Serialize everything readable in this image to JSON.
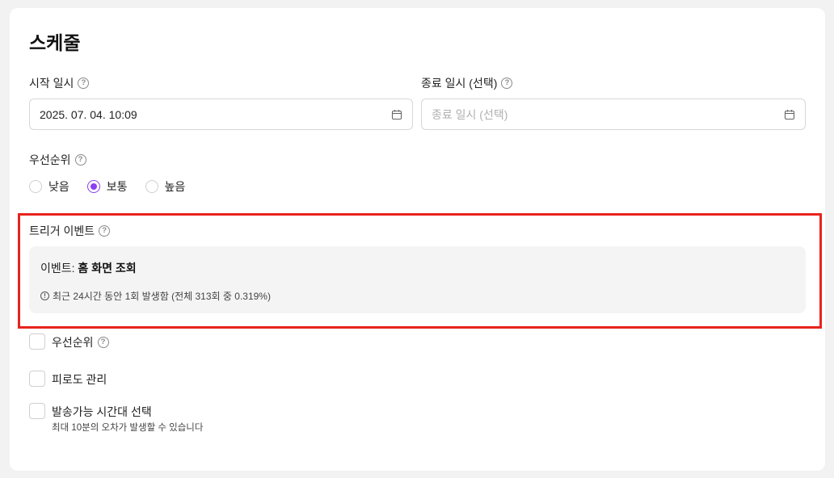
{
  "schedule": {
    "title": "스케줄",
    "start": {
      "label": "시작 일시",
      "value": "2025. 07. 04. 10:09"
    },
    "end": {
      "label": "종료 일시 (선택)",
      "placeholder": "종료 일시 (선택)"
    },
    "priority": {
      "label": "우선순위",
      "options": [
        "낮음",
        "보통",
        "높음"
      ],
      "selected": "보통"
    },
    "trigger": {
      "label": "트리거 이벤트",
      "event_prefix": "이벤트: ",
      "event_name": "홈 화면 조회",
      "stats": "최근 24시간 동안 1회 발생함 (전체 313회 중 0.319%)"
    },
    "options": {
      "priority_label": "우선순위",
      "fatigue_label": "피로도 관리",
      "time_window_label": "발송가능 시간대 선택",
      "time_window_note": "최대 10분의 오차가 발생할 수 있습니다"
    },
    "colors": {
      "accent": "#8a3ff0",
      "highlight": "#e8231d"
    }
  }
}
